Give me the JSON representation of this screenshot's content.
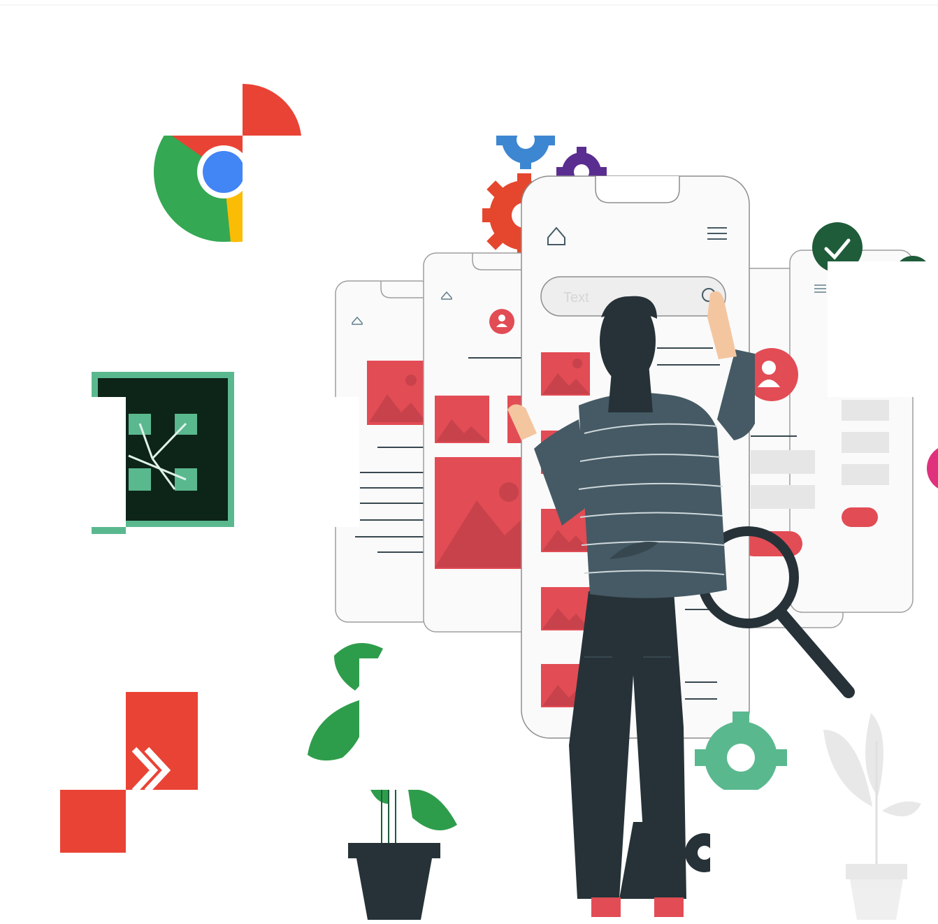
{
  "colors": {
    "background": "#ffffff",
    "accent_red": "#e24c55",
    "dark_red": "#c8424b",
    "dark_teal": "#263238",
    "shirt": "#455a64",
    "green": "#5ab88f",
    "dark_green": "#1f5c3a",
    "chrome_red": "#e94335",
    "chrome_green": "#34a853",
    "chrome_yellow": "#fbbc05",
    "chrome_blue": "#4285f4",
    "gear_blue": "#3d86d1",
    "gear_purple": "#5a2d91",
    "gear_orange": "#e5472e"
  },
  "icons": [
    "chrome-logo-icon",
    "adobe-connect-logo-icon",
    "red-arrow-logo-icon",
    "check-badge-icon",
    "gear-icon",
    "magnifying-glass-icon",
    "home-icon",
    "menu-icon",
    "user-avatar-icon",
    "image-placeholder-icon",
    "plant-icon"
  ],
  "illustration": {
    "search_field": {
      "placeholder": "Text"
    }
  }
}
